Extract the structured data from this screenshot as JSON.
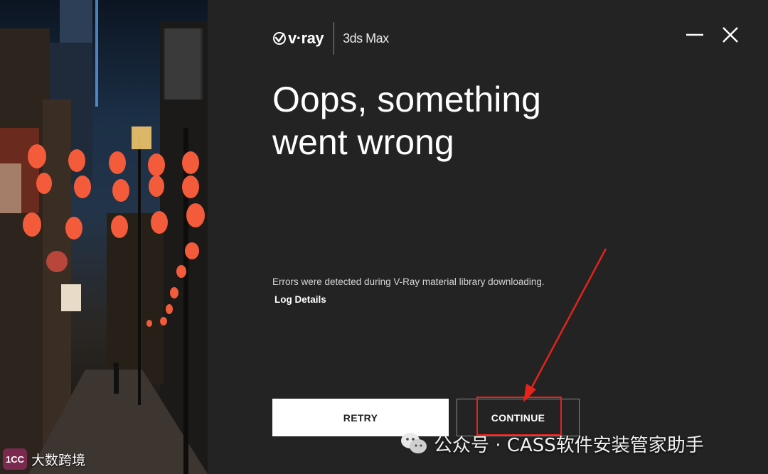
{
  "header": {
    "brand": "v·ray",
    "product": "3ds Max",
    "minimize_icon": "minimize-icon",
    "close_icon": "close-icon"
  },
  "main": {
    "heading_line1": "Oops, something",
    "heading_line2": "went wrong",
    "error_message": "Errors were detected during V-Ray material library downloading.",
    "log_link": "Log Details"
  },
  "buttons": {
    "retry": "RETRY",
    "continue": "CONTINUE"
  },
  "annotation": {
    "highlight_color": "#e5231b"
  },
  "overlay": {
    "left_logo_badge": "1CC",
    "left_logo_text": "大数跨境",
    "watermark_text": "公众号 · CASS软件安装管家助手",
    "watermark_icon": "wechat-icon"
  },
  "colors": {
    "panel_background": "#232323",
    "text": "#ffffff",
    "retry_background": "#ffffff"
  }
}
